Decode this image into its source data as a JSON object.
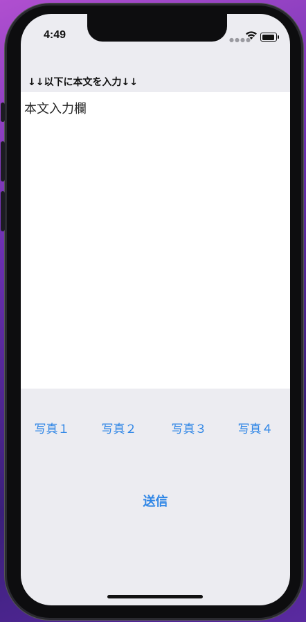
{
  "status_bar": {
    "time": "4:49",
    "signal_icon": "signal-dots",
    "wifi_icon": "wifi",
    "battery_icon": "battery-full"
  },
  "header": {
    "label": "↓↓以下に本文を入力↓↓"
  },
  "body_input": {
    "value": "本文入力欄"
  },
  "photos": {
    "buttons": [
      {
        "label": "写真１"
      },
      {
        "label": "写真２"
      },
      {
        "label": "写真３"
      },
      {
        "label": "写真４"
      }
    ]
  },
  "send": {
    "label": "送信"
  },
  "colors": {
    "accent": "#2f86e6",
    "background": "#ececf1",
    "text_area": "#ffffff"
  }
}
